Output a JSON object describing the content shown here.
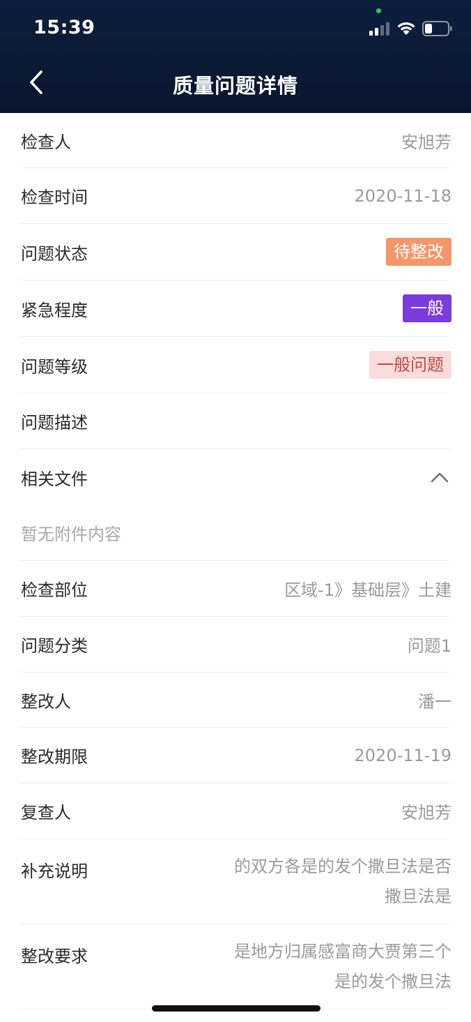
{
  "status_bar": {
    "time": "15:39"
  },
  "header": {
    "title": "质量问题详情",
    "back_icon": "chevron-left-icon"
  },
  "details": {
    "inspector": {
      "label": "检查人",
      "value": "安旭芳"
    },
    "inspection_time": {
      "label": "检查时间",
      "value": "2020-11-18"
    },
    "problem_status": {
      "label": "问题状态",
      "value": "待整改",
      "color": "#f5956a"
    },
    "urgency": {
      "label": "紧急程度",
      "value": "一般",
      "color": "#7a3cdd"
    },
    "problem_level": {
      "label": "问题等级",
      "value": "一般问题",
      "color": "#c24747"
    },
    "problem_description": {
      "label": "问题描述",
      "value": ""
    },
    "related_files": {
      "label": "相关文件",
      "empty_text": "暂无附件内容",
      "toggle_icon": "chevron-up-icon"
    },
    "inspection_location": {
      "label": "检查部位",
      "value": "区域-1》基础层》土建"
    },
    "problem_category": {
      "label": "问题分类",
      "value": "问题1"
    },
    "rectifier": {
      "label": "整改人",
      "value": "潘一"
    },
    "rectification_deadline": {
      "label": "整改期限",
      "value": "2020-11-19"
    },
    "reviewer": {
      "label": "复查人",
      "value": "安旭芳"
    },
    "supplementary_note": {
      "label": "补充说明",
      "value": "的双方各是的发个撒旦法是否撒旦法是"
    },
    "rectification_requirement": {
      "label": "整改要求",
      "value": "是地方归属感富商大贾第三个是的发个撒旦法"
    }
  }
}
